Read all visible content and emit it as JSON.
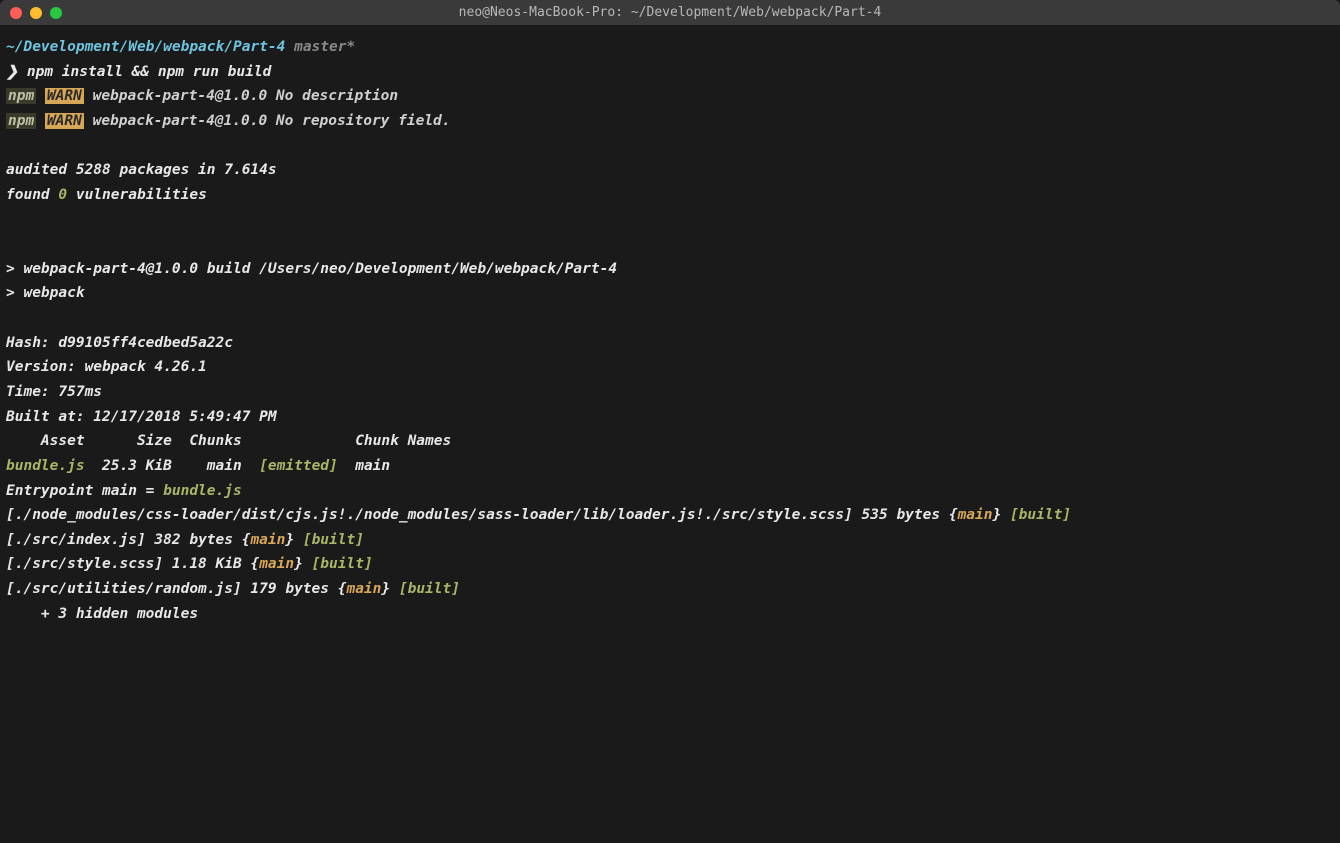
{
  "window": {
    "title": "neo@Neos-MacBook-Pro: ~/Development/Web/webpack/Part-4"
  },
  "prompt": {
    "path": "~/Development/Web/webpack/Part-4",
    "branch": "master*",
    "symbol": "❯",
    "command": "npm install && npm run build"
  },
  "warnings": [
    {
      "prefix": "npm",
      "level": "WARN",
      "message": " webpack-part-4@1.0.0 No description"
    },
    {
      "prefix": "npm",
      "level": "WARN",
      "message": " webpack-part-4@1.0.0 No repository field."
    }
  ],
  "audit": {
    "line1": "audited 5288 packages in 7.614s",
    "found_prefix": "found ",
    "count": "0",
    "found_suffix": " vulnerabilities"
  },
  "script": {
    "line1": "> webpack-part-4@1.0.0 build /Users/neo/Development/Web/webpack/Part-4",
    "line2": "> webpack"
  },
  "stats": {
    "hash": "Hash: d99105ff4cedbed5a22c",
    "version": "Version: webpack 4.26.1",
    "time": "Time: 757ms",
    "built_at": "Built at: 12/17/2018 5:49:47 PM"
  },
  "table": {
    "header": "    Asset      Size  Chunks             Chunk Names",
    "row": {
      "asset": "bundle.js",
      "mid": "  25.3 KiB    main  ",
      "emitted": "[emitted]",
      "chunk": "  main"
    }
  },
  "entrypoint": {
    "prefix": "Entrypoint main = ",
    "file": "bundle.js"
  },
  "modules": [
    {
      "path": "[./node_modules/css-loader/dist/cjs.js!./node_modules/sass-loader/lib/loader.js!./src/style.scss]",
      "size": " 535 bytes ",
      "chunk": "main",
      "status": "[built]"
    },
    {
      "path": "[./src/index.js]",
      "size": " 382 bytes ",
      "chunk": "main",
      "status": "[built]"
    },
    {
      "path": "[./src/style.scss]",
      "size": " 1.18 KiB ",
      "chunk": "main",
      "status": "[built]"
    },
    {
      "path": "[./src/utilities/random.js]",
      "size": " 179 bytes ",
      "chunk": "main",
      "status": "[built]"
    }
  ],
  "hidden": "    + 3 hidden modules",
  "braces": {
    "open": "{",
    "close": "} "
  }
}
